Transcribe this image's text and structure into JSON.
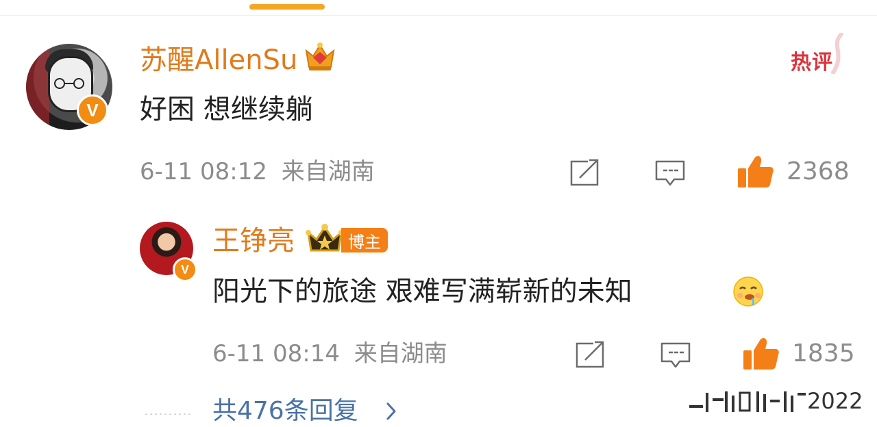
{
  "comment": {
    "username": "苏醒AllenSu",
    "text": "好困 想继续躺",
    "timestamp": "6-11 08:12",
    "location": "来自湖南",
    "likes": "2368",
    "hot_label": "热评",
    "verified_icon": "v-icon",
    "rank_icon": "crown-icon"
  },
  "reply": {
    "username": "王铮亮",
    "author_tag": "博主",
    "text": "阳光下的旅途 艰难写满崭新的未知",
    "emoji": "drooling-face-emoji",
    "timestamp": "6-11 08:14",
    "location": "来自湖南",
    "likes": "1835",
    "verified_icon": "v-icon",
    "rank_icon": "crown-icon"
  },
  "more_replies": {
    "label": "共476条回复",
    "icon": "chevron-right-icon"
  },
  "watermark": {
    "text": "2022"
  },
  "colors": {
    "username": "#e07b1d",
    "hot_label": "#d9343e",
    "like_icon": "#f57f17",
    "link": "#4a72a6",
    "meta": "#8c8c8c",
    "indicator": "#f5a623"
  }
}
